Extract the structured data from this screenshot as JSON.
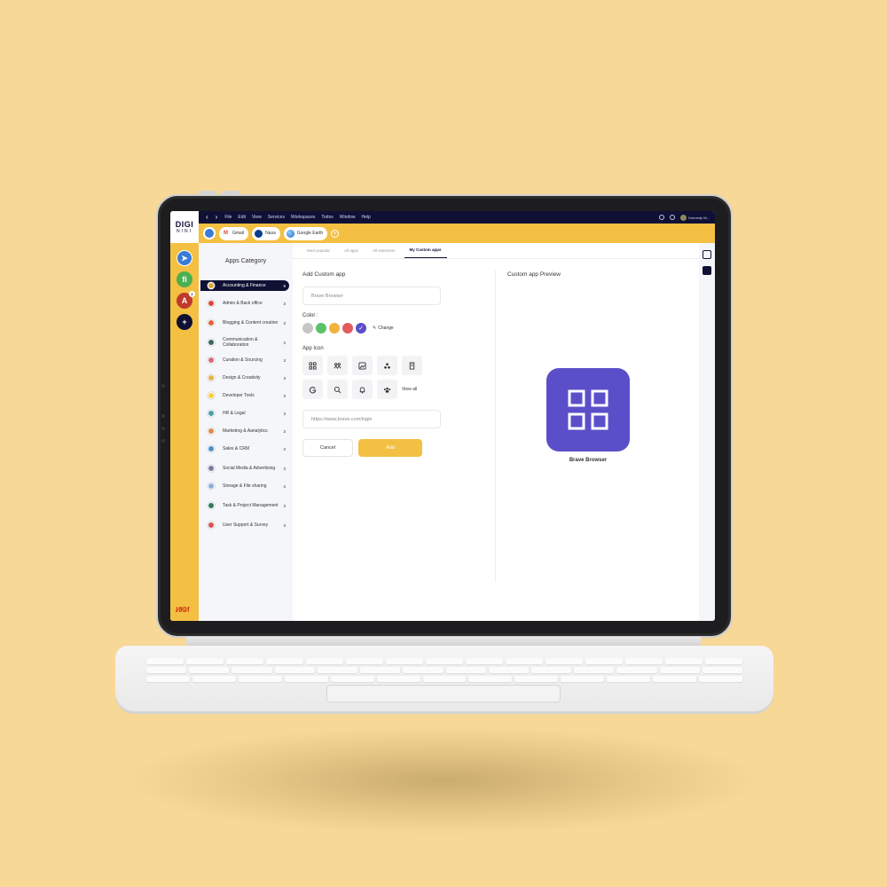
{
  "logo": {
    "line1": "DIGI",
    "line2": "NINI"
  },
  "menubar": {
    "items": [
      "File",
      "Edit",
      "View",
      "Services",
      "Workspaces",
      "Todos",
      "Window",
      "Help"
    ],
    "user_name": "Kennedy W..."
  },
  "open_tabs": [
    {
      "label": "Gmail",
      "icon": "gmail-icon",
      "color": "#ea4335"
    },
    {
      "label": "Nasa",
      "icon": "nasa-icon",
      "color": "#0b3d91"
    },
    {
      "label": "Google Earth",
      "icon": "google-earth-icon",
      "color": "#4285f4"
    }
  ],
  "rail": {
    "badge": "2"
  },
  "category": {
    "title": "Apps Category",
    "items": [
      {
        "label": "Accounting & Finance",
        "count": "9",
        "color": "#d8a83a"
      },
      {
        "label": "Admin & Back office",
        "count": "3",
        "color": "#e0453a"
      },
      {
        "label": "Blogging & Content creation",
        "count": "3",
        "color": "#e2603c"
      },
      {
        "label": "Communication & Collaboration",
        "count": "3",
        "color": "#3b6b5a"
      },
      {
        "label": "Curation & Sourcing",
        "count": "3",
        "color": "#d86a7a"
      },
      {
        "label": "Design & Creativity",
        "count": "3",
        "color": "#e2b34a"
      },
      {
        "label": "Developer Tools",
        "count": "3",
        "color": "#f2d13a"
      },
      {
        "label": "HR & Legal",
        "count": "3",
        "color": "#4aa0a8"
      },
      {
        "label": "Marketing & Aanalytics",
        "count": "3",
        "color": "#e08a4a"
      },
      {
        "label": "Sales & CRM",
        "count": "3",
        "color": "#4a90d0"
      },
      {
        "label": "Social Media & Advertising",
        "count": "3",
        "color": "#7a7aa8"
      },
      {
        "label": "Storage & File sharing",
        "count": "3",
        "color": "#8ab0e0"
      },
      {
        "label": "Task & Project Management",
        "count": "3",
        "color": "#2f7a5a"
      },
      {
        "label": "User Support & Survey",
        "count": "3",
        "color": "#d85050"
      }
    ]
  },
  "subtabs": [
    "Most popular",
    "All apps",
    "All extension",
    "My Custom apps"
  ],
  "form": {
    "title": "Add Custom app",
    "name_placeholder": "Brave Browser",
    "color_label": "Color :",
    "colors": [
      "#c6c6c6",
      "#5cc26a",
      "#f3b13d",
      "#e25c5c",
      "#5b4fc9"
    ],
    "selected_color": "#5b4fc9",
    "change_label": "Change",
    "icon_label": "App Icon",
    "view_all": "View all",
    "url_placeholder": "https://www.brave.com/login",
    "cancel": "Cancel",
    "add": "Add"
  },
  "preview": {
    "title": "Custom app Preview",
    "app_name": "Brave Browser",
    "icon_color": "#5b4fc9"
  }
}
